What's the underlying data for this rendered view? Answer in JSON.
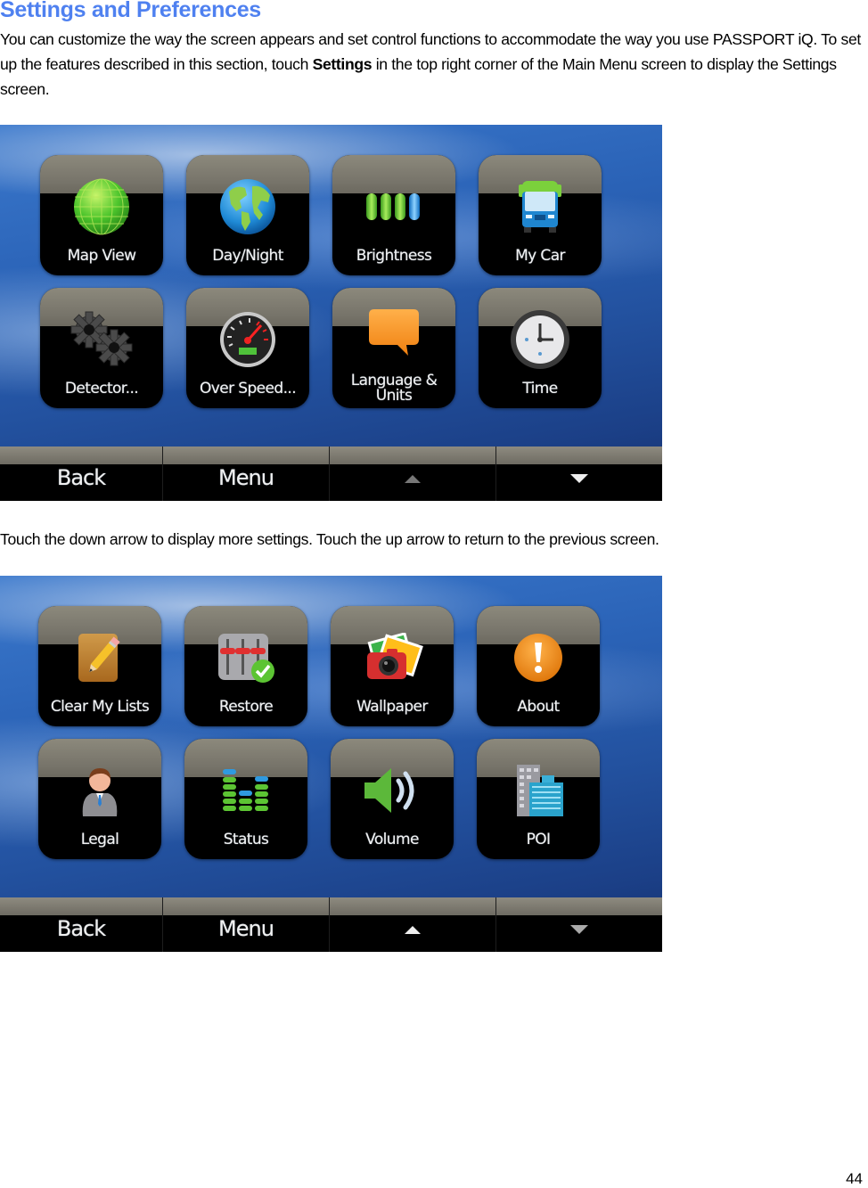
{
  "heading": "Settings and Preferences",
  "intro": {
    "text_before": "You can customize the way the screen appears and set control functions to accommodate the way you use PASSPORT iQ. To set up the features described in this section, touch ",
    "bold": "Settings",
    "text_after": " in the top right corner of the Main Menu screen to display the Settings screen."
  },
  "between_text": "Touch the down arrow to display more settings. Touch the up arrow to return to the previous screen.",
  "page_number": "44",
  "screen1": {
    "tiles": [
      {
        "label": "Map View",
        "icon": "globe-grid-icon"
      },
      {
        "label": "Day/Night",
        "icon": "earth-icon"
      },
      {
        "label": "Brightness",
        "icon": "brightness-bars-icon"
      },
      {
        "label": "My Car",
        "icon": "bus-icon"
      },
      {
        "label": "Detector...",
        "icon": "gears-icon"
      },
      {
        "label": "Over Speed...",
        "icon": "speedometer-icon"
      },
      {
        "label": "Language &\nUnits",
        "label_line1": "Language &",
        "label_line2": "Units",
        "icon": "speech-bubble-icon"
      },
      {
        "label": "Time",
        "icon": "clock-icon"
      }
    ],
    "navbar": {
      "back": "Back",
      "menu": "Menu",
      "up_icon": "up-arrow-icon",
      "down_icon": "down-arrow-icon",
      "up_enabled": false,
      "down_enabled": true
    }
  },
  "screen2": {
    "tiles": [
      {
        "label": "Clear My Lists",
        "icon": "notepad-pencil-icon"
      },
      {
        "label": "Restore",
        "icon": "sliders-check-icon"
      },
      {
        "label": "Wallpaper",
        "icon": "camera-photos-icon"
      },
      {
        "label": "About",
        "icon": "exclamation-icon"
      },
      {
        "label": "Legal",
        "icon": "person-suit-icon"
      },
      {
        "label": "Status",
        "icon": "level-bars-icon"
      },
      {
        "label": "Volume",
        "icon": "speaker-icon"
      },
      {
        "label": "POI",
        "icon": "buildings-icon"
      }
    ],
    "navbar": {
      "back": "Back",
      "menu": "Menu",
      "up_icon": "up-arrow-icon",
      "down_icon": "down-arrow-icon",
      "up_enabled": true,
      "down_enabled": false
    }
  },
  "colors": {
    "heading": "#4f81f0",
    "screen_bg": "#2a62b6",
    "tile_band": "#7f7c71",
    "tile_body": "#000000"
  }
}
